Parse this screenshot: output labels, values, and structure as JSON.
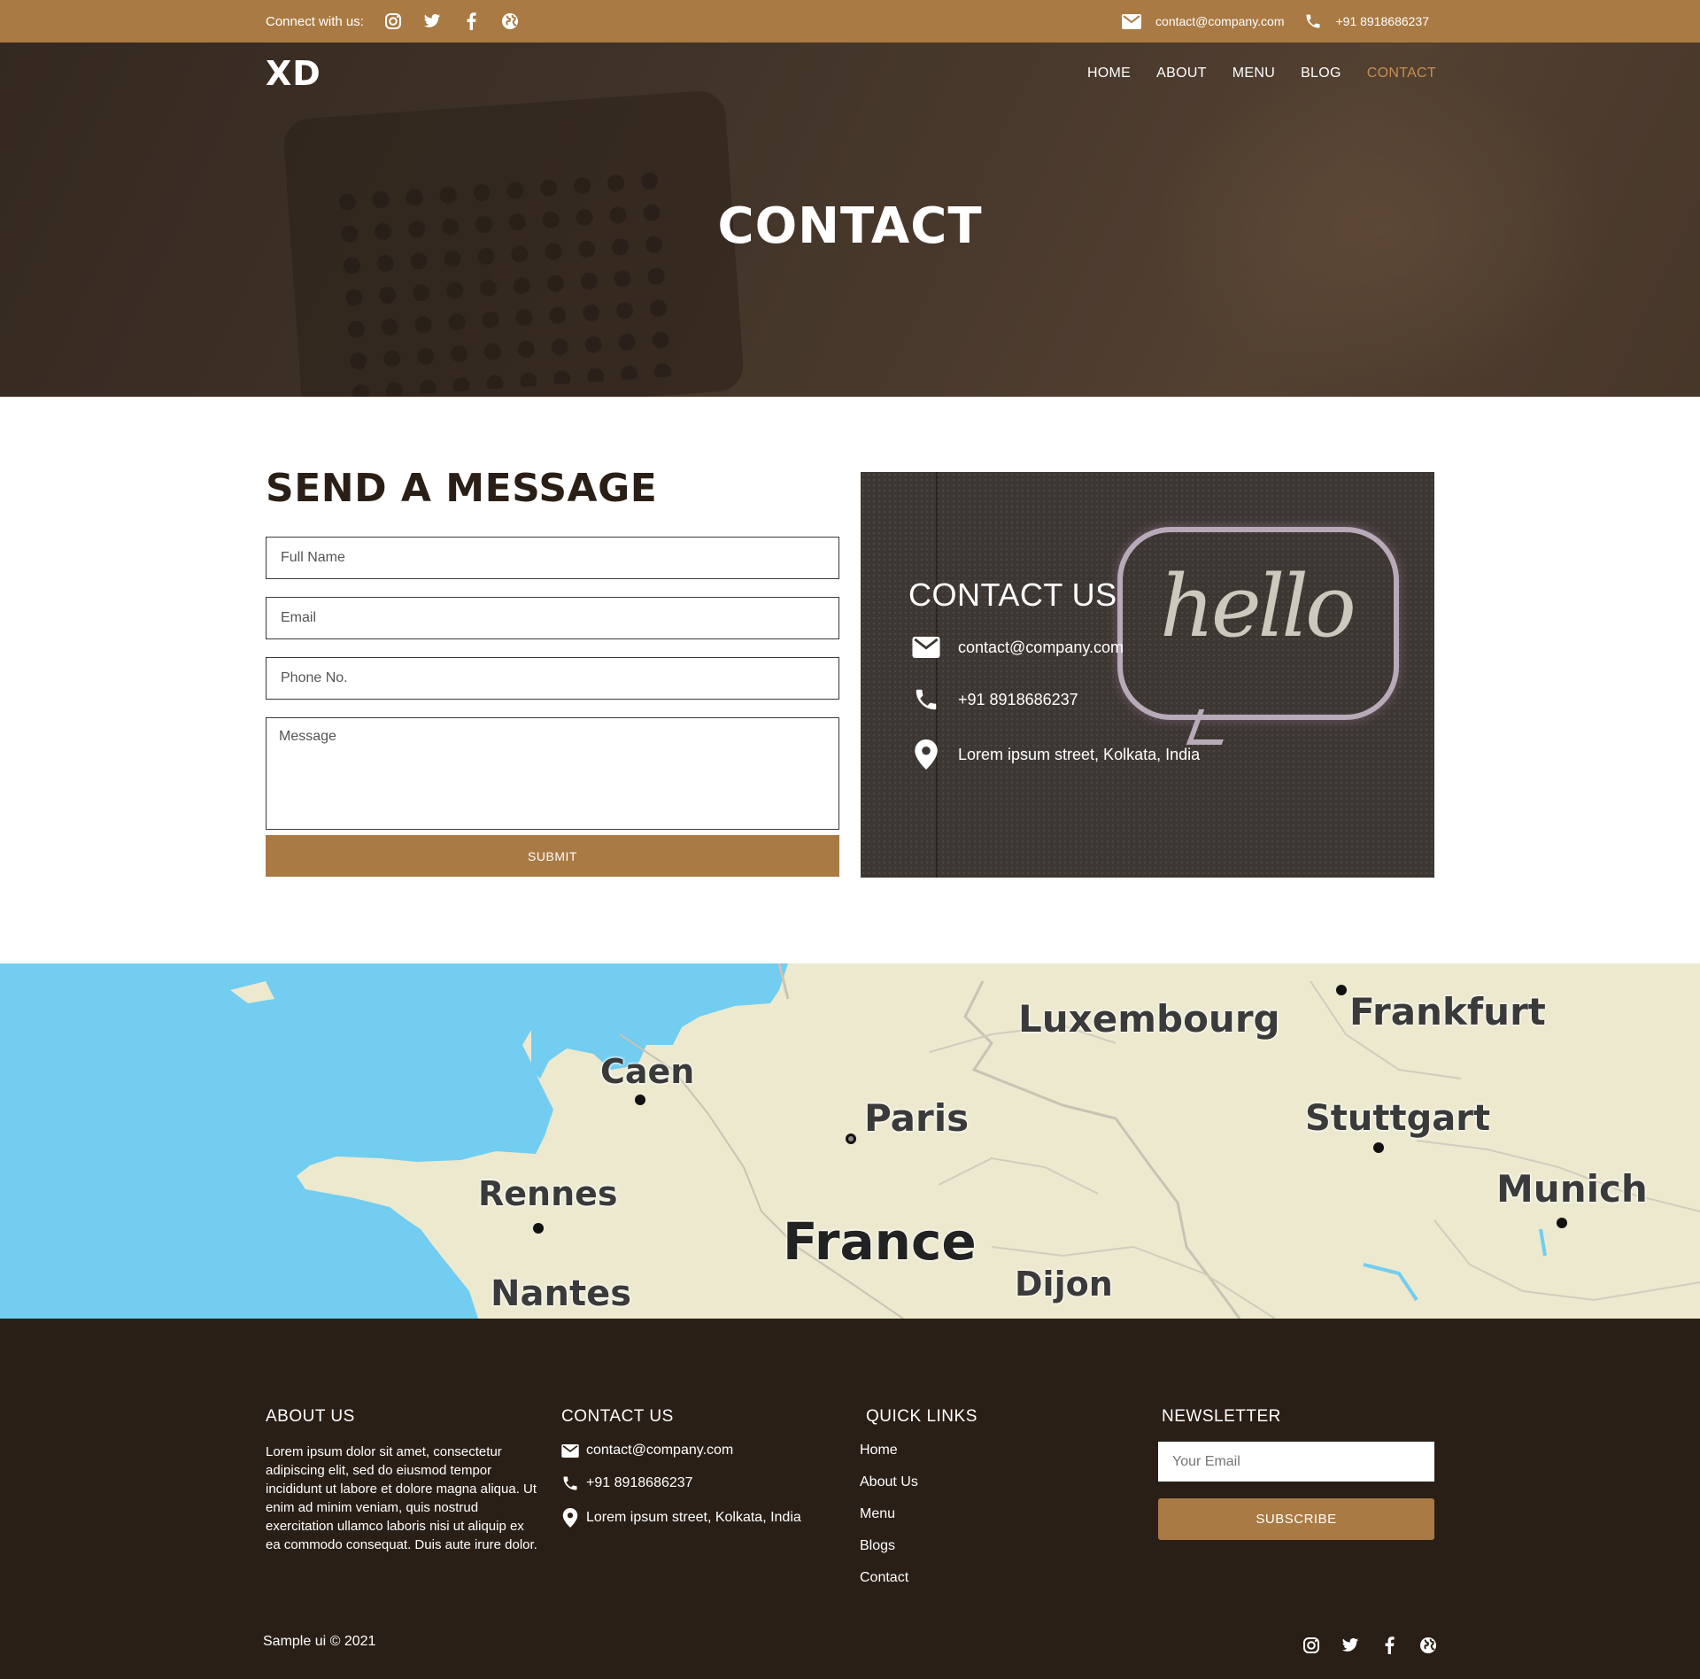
{
  "topbar": {
    "connect_label": "Connect with us:",
    "social_icons": [
      "instagram-icon",
      "twitter-icon",
      "facebook-icon",
      "globe-icon"
    ],
    "email": "contact@company.com",
    "phone": "+91 8918686237"
  },
  "nav": {
    "logo": "XD",
    "items": [
      {
        "label": "HOME",
        "active": false
      },
      {
        "label": "ABOUT",
        "active": false
      },
      {
        "label": "MENU",
        "active": false
      },
      {
        "label": "BLOG",
        "active": false
      },
      {
        "label": "CONTACT",
        "active": true
      }
    ]
  },
  "hero": {
    "title": "CONTACT"
  },
  "message_form": {
    "title": "SEND A MESSAGE",
    "full_name_placeholder": "Full Name",
    "email_placeholder": "Email",
    "phone_placeholder": "Phone No.",
    "message_placeholder": "Message",
    "submit_label": "SUBMIT"
  },
  "contact_card": {
    "title": "CONTACT US",
    "sign_text": "hello",
    "email": "contact@company.com",
    "phone": "+91 8918686237",
    "address": "Lorem ipsum street, Kolkata, India"
  },
  "map": {
    "labels": [
      "Luxembourg",
      "Frankfurt",
      "Caen",
      "Paris",
      "Stuttgart",
      "Rennes",
      "France",
      "Munich",
      "Dijon",
      "Nantes"
    ]
  },
  "footer": {
    "about": {
      "title": "ABOUT US",
      "text": "Lorem ipsum dolor sit amet, consectetur adipiscing elit, sed do eiusmod tempor incididunt ut labore et dolore magna aliqua. Ut enim ad minim veniam, quis nostrud exercitation ullamco laboris nisi ut aliquip ex ea commodo consequat. Duis aute irure dolor."
    },
    "contact": {
      "title": "CONTACT US",
      "email": "contact@company.com",
      "phone": "+91 8918686237",
      "address": "Lorem ipsum street, Kolkata, India"
    },
    "quick_links": {
      "title": "QUICK LINKS",
      "items": [
        "Home",
        "About Us",
        "Menu",
        "Blogs",
        "Contact"
      ]
    },
    "newsletter": {
      "title": "NEWSLETTER",
      "placeholder": "Your Email",
      "button_label": "SUBSCRIBE"
    },
    "copyright": "Sample ui © 2021"
  },
  "colors": {
    "accent": "#a97a43",
    "footer_bg": "#2a1f17",
    "nav_active": "#c8904f",
    "sea": "#72cdf0",
    "land": "#ece9cf"
  }
}
